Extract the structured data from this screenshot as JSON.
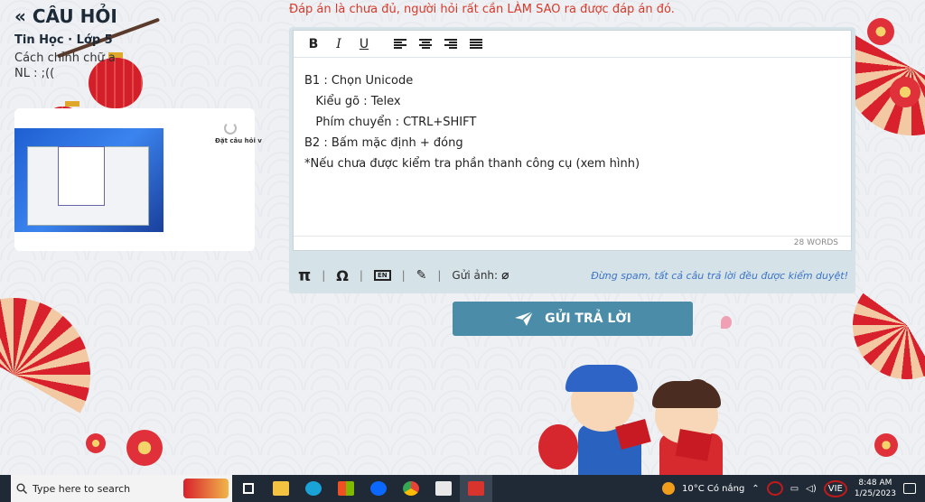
{
  "header": {
    "back_title": "« CÂU HỎI",
    "subject": "Tin Học · Lớp 5",
    "question_line1": "Cách chỉnh chữ a",
    "question_line2": "NL : ;(("
  },
  "thumbnail": {
    "caption": "Đặt câu hỏi v"
  },
  "editor": {
    "notice": "Đáp án là chưa đủ, người hỏi rất cần LÀM SAO ra được đáp án đó.",
    "toolbar": {
      "bold": "B",
      "italic": "I",
      "underline": "U"
    },
    "content_lines": [
      "B1 : Chọn Unicode",
      "   Kiểu gõ : Telex",
      "   Phím chuyển : CTRL+SHIFT",
      "B2 : Bấm mặc định + đóng",
      "*Nếu chưa được kiểm tra phần thanh công cụ (xem hình)"
    ],
    "word_count": "28 WORDS",
    "bottom": {
      "pi": "π",
      "omega": "Ω",
      "keyboard": "EN",
      "send_image_label": "Gửi ảnh:",
      "spam_note": "Đừng spam, tất cả câu trả lời đều được kiểm duyệt!"
    }
  },
  "submit_label": "GỬI TRẢ LỜI",
  "taskbar": {
    "search_placeholder": "Type here to search",
    "weather": "10°C  Có nắng",
    "language": "VIE",
    "time": "8:48 AM",
    "date": "1/25/2023"
  },
  "colors": {
    "submit": "#4b8da9",
    "notice": "#d63a2b",
    "spam_note": "#3b74c6",
    "taskbar": "#202a36"
  }
}
